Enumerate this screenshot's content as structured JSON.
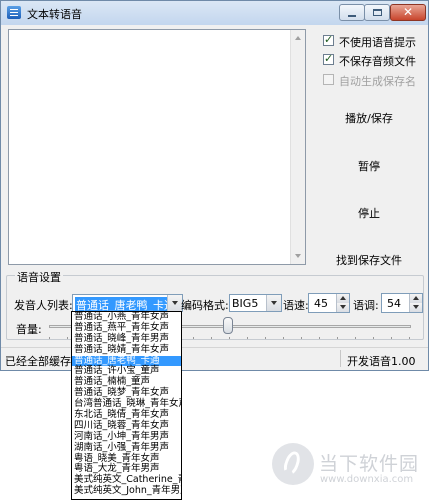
{
  "window": {
    "title": "文本转语音",
    "controls": {
      "minimize": "min",
      "maximize": "max",
      "close": "✕"
    }
  },
  "options": [
    {
      "label": "不使用语音提示",
      "checked": true,
      "enabled": true
    },
    {
      "label": "不保存音频文件",
      "checked": true,
      "enabled": true
    },
    {
      "label": "自动生成保存名",
      "checked": false,
      "enabled": false
    }
  ],
  "buttons": {
    "play_save": "播放/保存",
    "pause": "暂停",
    "stop": "停止",
    "find_file": "找到保存文件"
  },
  "voice_settings": {
    "group_label": "语音设置",
    "speaker_label": "发音人列表:",
    "speaker_value": "普通话_唐老鸭_卡通",
    "encoding_label": "编码格式:",
    "encoding_value": "BIG5",
    "speed_label": "语速:",
    "speed_value": "45",
    "pitch_label": "语调:",
    "pitch_value": "54",
    "volume_label": "音量:"
  },
  "status": {
    "left": "已经全部缓存!",
    "right": "开发语音1.00"
  },
  "speaker_options": [
    "普通话_小燕_青年女声",
    "普通话_燕平_青年女声",
    "普通话_晓峰_青年男声",
    "普通话_晓婧_青年女声",
    "普通话_唐老鸭_卡通",
    "普通话_许小宝_童声",
    "普通话_楠楠_童声",
    "普通话_晓梦_青年女声",
    "台湾普通话_晓琳_青年女声",
    "东北话_晓倩_青年女声",
    "四川话_晓蓉_青年女声",
    "河南话_小坤_青年男声",
    "湖南话_小强_青年男声",
    "粤语_晓美_青年女声",
    "粤语_大龙_青年男声",
    "美式纯英文_Catherine_青年女声",
    "美式纯英文_John_青年男声"
  ],
  "selected_speaker_index": 4,
  "watermark": {
    "title": "当下软件园",
    "url": "www.downxia.com"
  }
}
